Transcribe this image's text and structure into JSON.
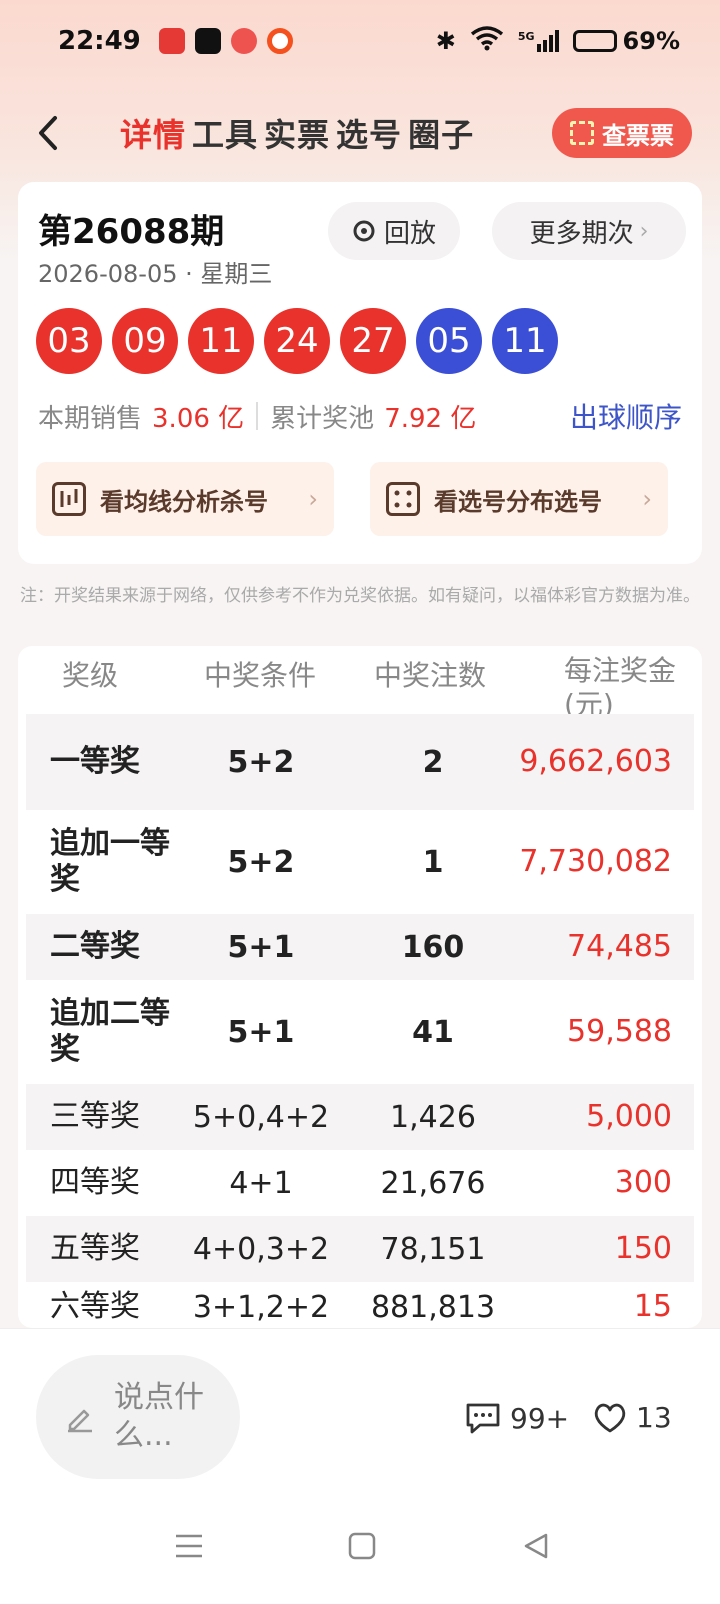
{
  "status": {
    "time": "22:49",
    "battery": "69%",
    "battery_level": 0.69,
    "network": "5G"
  },
  "header": {
    "tabs": [
      {
        "label": "详情",
        "active": true
      },
      {
        "label": "工具",
        "active": false
      },
      {
        "label": "实票",
        "active": false
      },
      {
        "label": "选号",
        "active": false
      },
      {
        "label": "圈子",
        "active": false
      }
    ],
    "check_ticket_label": "查票票"
  },
  "draw": {
    "issue": "第26088期",
    "date": "2026-08-05",
    "weekday": "星期三",
    "replay_label": "回放",
    "more_label": "更多期次",
    "red_balls": [
      "03",
      "09",
      "11",
      "24",
      "27"
    ],
    "blue_balls": [
      "05",
      "11"
    ],
    "sales_label": "本期销售",
    "sales_value": "3.06 亿",
    "pool_label": "累计奖池",
    "pool_value": "7.92 亿",
    "order_label": "出球顺序",
    "analysis_1": "看均线分析杀号",
    "analysis_2": "看选号分布选号"
  },
  "disclaimer": "注：开奖结果来源于网络，仅供参考不作为兑奖依据。如有疑问，以福体彩官方数据为准。",
  "prize_table": {
    "headers": {
      "level": "奖级",
      "condition": "中奖条件",
      "count": "中奖注数",
      "amount": "每注奖金(元)"
    },
    "rows": [
      {
        "level": "一等奖",
        "condition": "5+2",
        "count": "2",
        "amount": "9,662,603"
      },
      {
        "level": "追加一等奖",
        "condition": "5+2",
        "count": "1",
        "amount": "7,730,082"
      },
      {
        "level": "二等奖",
        "condition": "5+1",
        "count": "160",
        "amount": "74,485"
      },
      {
        "level": "追加二等奖",
        "condition": "5+1",
        "count": "41",
        "amount": "59,588"
      },
      {
        "level": "三等奖",
        "condition": "5+0,4+2",
        "count": "1,426",
        "amount": "5,000"
      },
      {
        "level": "四等奖",
        "condition": "4+1",
        "count": "21,676",
        "amount": "300"
      },
      {
        "level": "五等奖",
        "condition": "4+0,3+2",
        "count": "78,151",
        "amount": "150"
      },
      {
        "level": "六等奖",
        "condition": "3+1,2+2",
        "count": "881,813",
        "amount": "15"
      }
    ]
  },
  "comment_bar": {
    "placeholder": "说点什么...",
    "comment_count": "99+",
    "like_count": "13"
  },
  "colors": {
    "red": "#e8322b",
    "blue": "#3b4fd6",
    "link": "#3d55c8"
  }
}
